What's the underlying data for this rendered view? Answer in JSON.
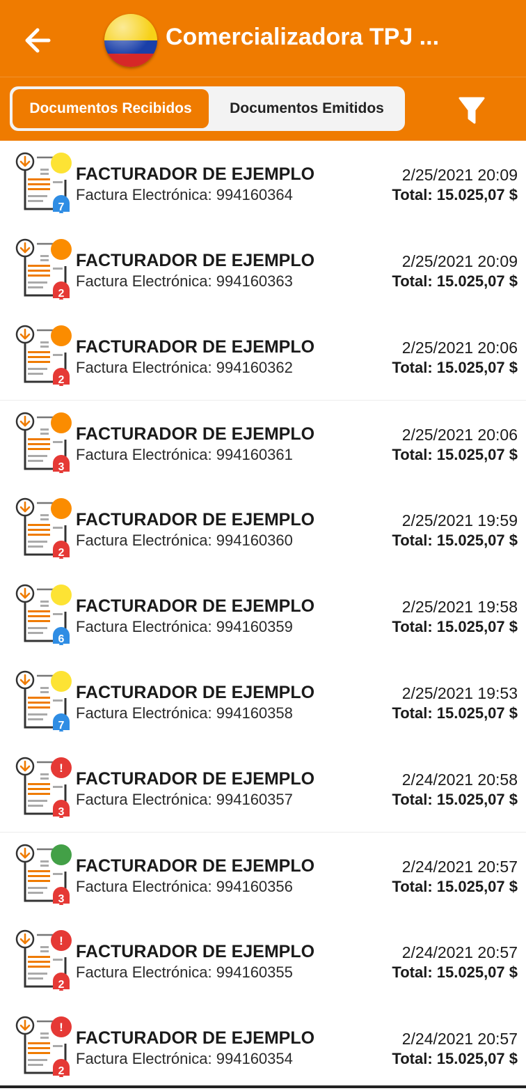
{
  "header": {
    "title": "Comercializadora TPJ ...",
    "back_icon": "arrow-left-icon",
    "flag_icon": "colombia-flag-icon",
    "filter_icon": "filter-funnel-icon",
    "background": "#ef7b00"
  },
  "tabs": [
    {
      "label": "Documentos Recibidos",
      "active": true
    },
    {
      "label": "Documentos Emitidos",
      "active": false
    }
  ],
  "status_colors": {
    "yellow": "#fde334",
    "orange": "#fb8c00",
    "red": "#e53935",
    "green": "#43a047"
  },
  "bell_colors": {
    "blue": "#2f8de4",
    "red": "#e53935"
  },
  "documents": [
    {
      "issuer": "FACTURADOR DE EJEMPLO",
      "doc": "Factura Electrónica: 994160364",
      "date": "2/25/2021 20:09",
      "total": "Total: 15.025,07 $",
      "status": "yellow",
      "bell": "blue",
      "count": "7"
    },
    {
      "issuer": "FACTURADOR DE EJEMPLO",
      "doc": "Factura Electrónica: 994160363",
      "date": "2/25/2021 20:09",
      "total": "Total: 15.025,07 $",
      "status": "orange",
      "bell": "red",
      "count": "2"
    },
    {
      "issuer": "FACTURADOR DE EJEMPLO",
      "doc": "Factura Electrónica: 994160362",
      "date": "2/25/2021 20:06",
      "total": "Total: 15.025,07 $",
      "status": "orange",
      "bell": "red",
      "count": "2"
    },
    {
      "issuer": "FACTURADOR DE EJEMPLO",
      "doc": "Factura Electrónica: 994160361",
      "date": "2/25/2021 20:06",
      "total": "Total: 15.025,07 $",
      "status": "orange",
      "bell": "red",
      "count": "3"
    },
    {
      "issuer": "FACTURADOR DE EJEMPLO",
      "doc": "Factura Electrónica: 994160360",
      "date": "2/25/2021 19:59",
      "total": "Total: 15.025,07 $",
      "status": "orange",
      "bell": "red",
      "count": "2"
    },
    {
      "issuer": "FACTURADOR DE EJEMPLO",
      "doc": "Factura Electrónica: 994160359",
      "date": "2/25/2021 19:58",
      "total": "Total: 15.025,07 $",
      "status": "yellow",
      "bell": "blue",
      "count": "6"
    },
    {
      "issuer": "FACTURADOR DE EJEMPLO",
      "doc": "Factura Electrónica: 994160358",
      "date": "2/25/2021 19:53",
      "total": "Total: 15.025,07 $",
      "status": "yellow",
      "bell": "blue",
      "count": "7"
    },
    {
      "issuer": "FACTURADOR DE EJEMPLO",
      "doc": "Factura Electrónica: 994160357",
      "date": "2/24/2021 20:58",
      "total": "Total: 15.025,07 $",
      "status": "red",
      "bell": "red",
      "count": "3"
    },
    {
      "issuer": "FACTURADOR DE EJEMPLO",
      "doc": "Factura Electrónica: 994160356",
      "date": "2/24/2021 20:57",
      "total": "Total: 15.025,07 $",
      "status": "green",
      "bell": "red",
      "count": "3"
    },
    {
      "issuer": "FACTURADOR DE EJEMPLO",
      "doc": "Factura Electrónica: 994160355",
      "date": "2/24/2021 20:57",
      "total": "Total: 15.025,07 $",
      "status": "red",
      "bell": "red",
      "count": "2"
    },
    {
      "issuer": "FACTURADOR DE EJEMPLO",
      "doc": "Factura Electrónica: 994160354",
      "date": "2/24/2021 20:57",
      "total": "Total: 15.025,07 $",
      "status": "red",
      "bell": "red",
      "count": "2"
    }
  ]
}
